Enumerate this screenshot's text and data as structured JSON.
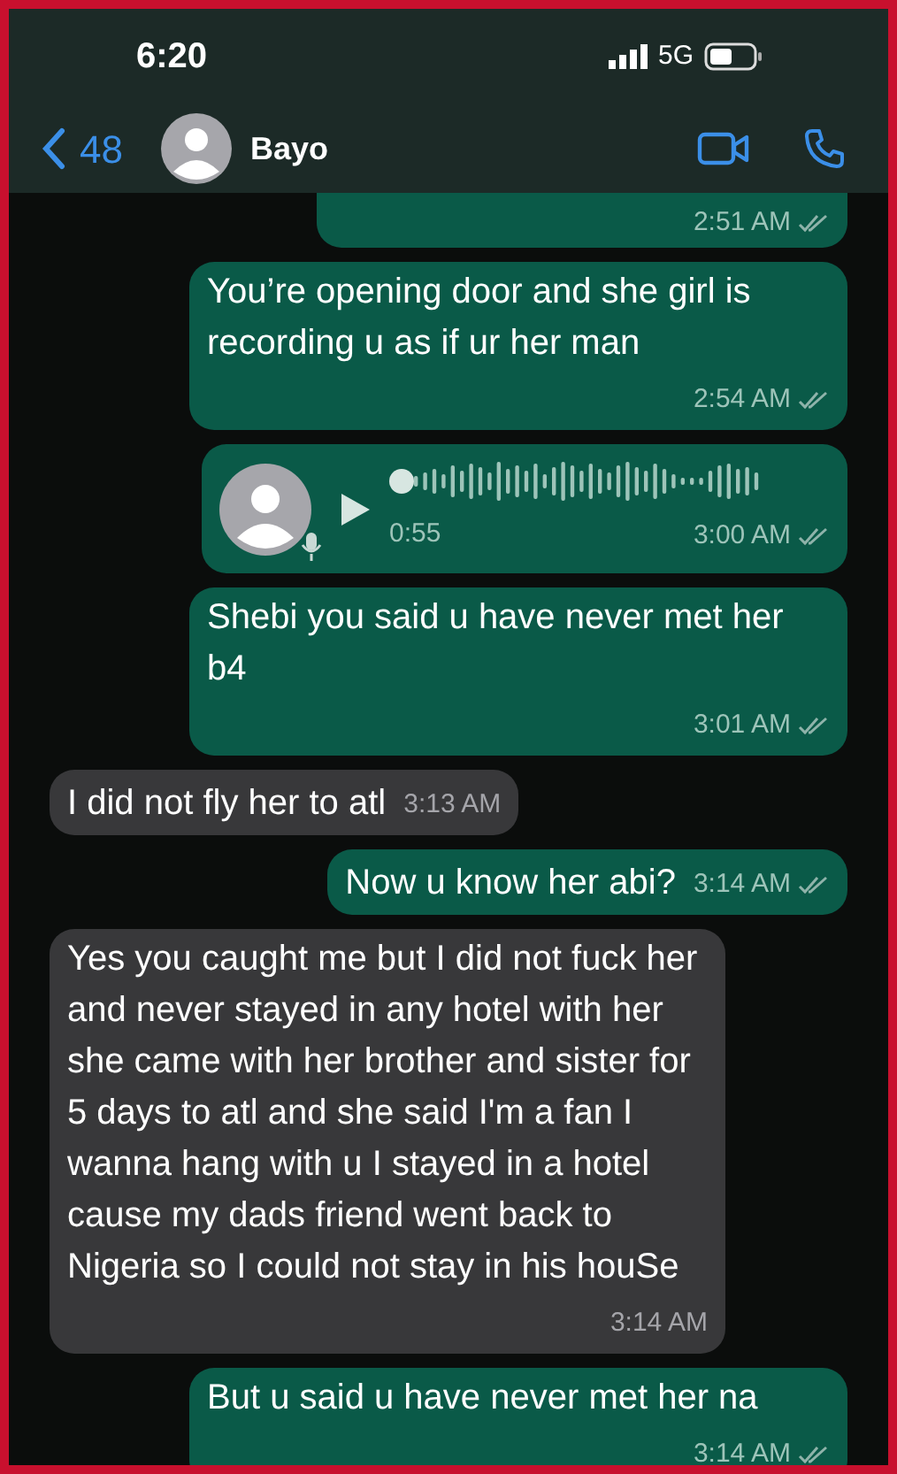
{
  "status_bar": {
    "time": "6:20",
    "network": "5G"
  },
  "header": {
    "back_count": "48",
    "contact_name": "Bayo"
  },
  "messages": [
    {
      "kind": "time_only",
      "outgoing": true,
      "time": "2:51 AM",
      "read": false
    },
    {
      "kind": "text",
      "outgoing": true,
      "text": "You’re opening door and she girl is recording u as if ur her man",
      "time": "2:54 AM",
      "read": false
    },
    {
      "kind": "voice",
      "outgoing": true,
      "duration": "0:55",
      "time": "3:00 AM",
      "read": false
    },
    {
      "kind": "text",
      "outgoing": true,
      "text": "Shebi you said u have never met her b4",
      "time": "3:01 AM",
      "read": false
    },
    {
      "kind": "text",
      "outgoing": false,
      "text": "I did not fly her to atl",
      "time": "3:13 AM"
    },
    {
      "kind": "text",
      "outgoing": true,
      "text": "Now u know her abi?",
      "time": "3:14 AM",
      "read": false
    },
    {
      "kind": "text",
      "outgoing": false,
      "text": "Yes you caught me but I did not fuck her and never stayed in any hotel with her she came with her brother and sister for 5 days to atl and she said I'm a fan I wanna hang with u I stayed in a hotel cause my dads friend went back to Nigeria so I could not stay in his houSe",
      "time": "3:14 AM"
    },
    {
      "kind": "text",
      "outgoing": true,
      "text": "But u said u have never met her na",
      "time": "3:14 AM",
      "read": false
    }
  ]
}
